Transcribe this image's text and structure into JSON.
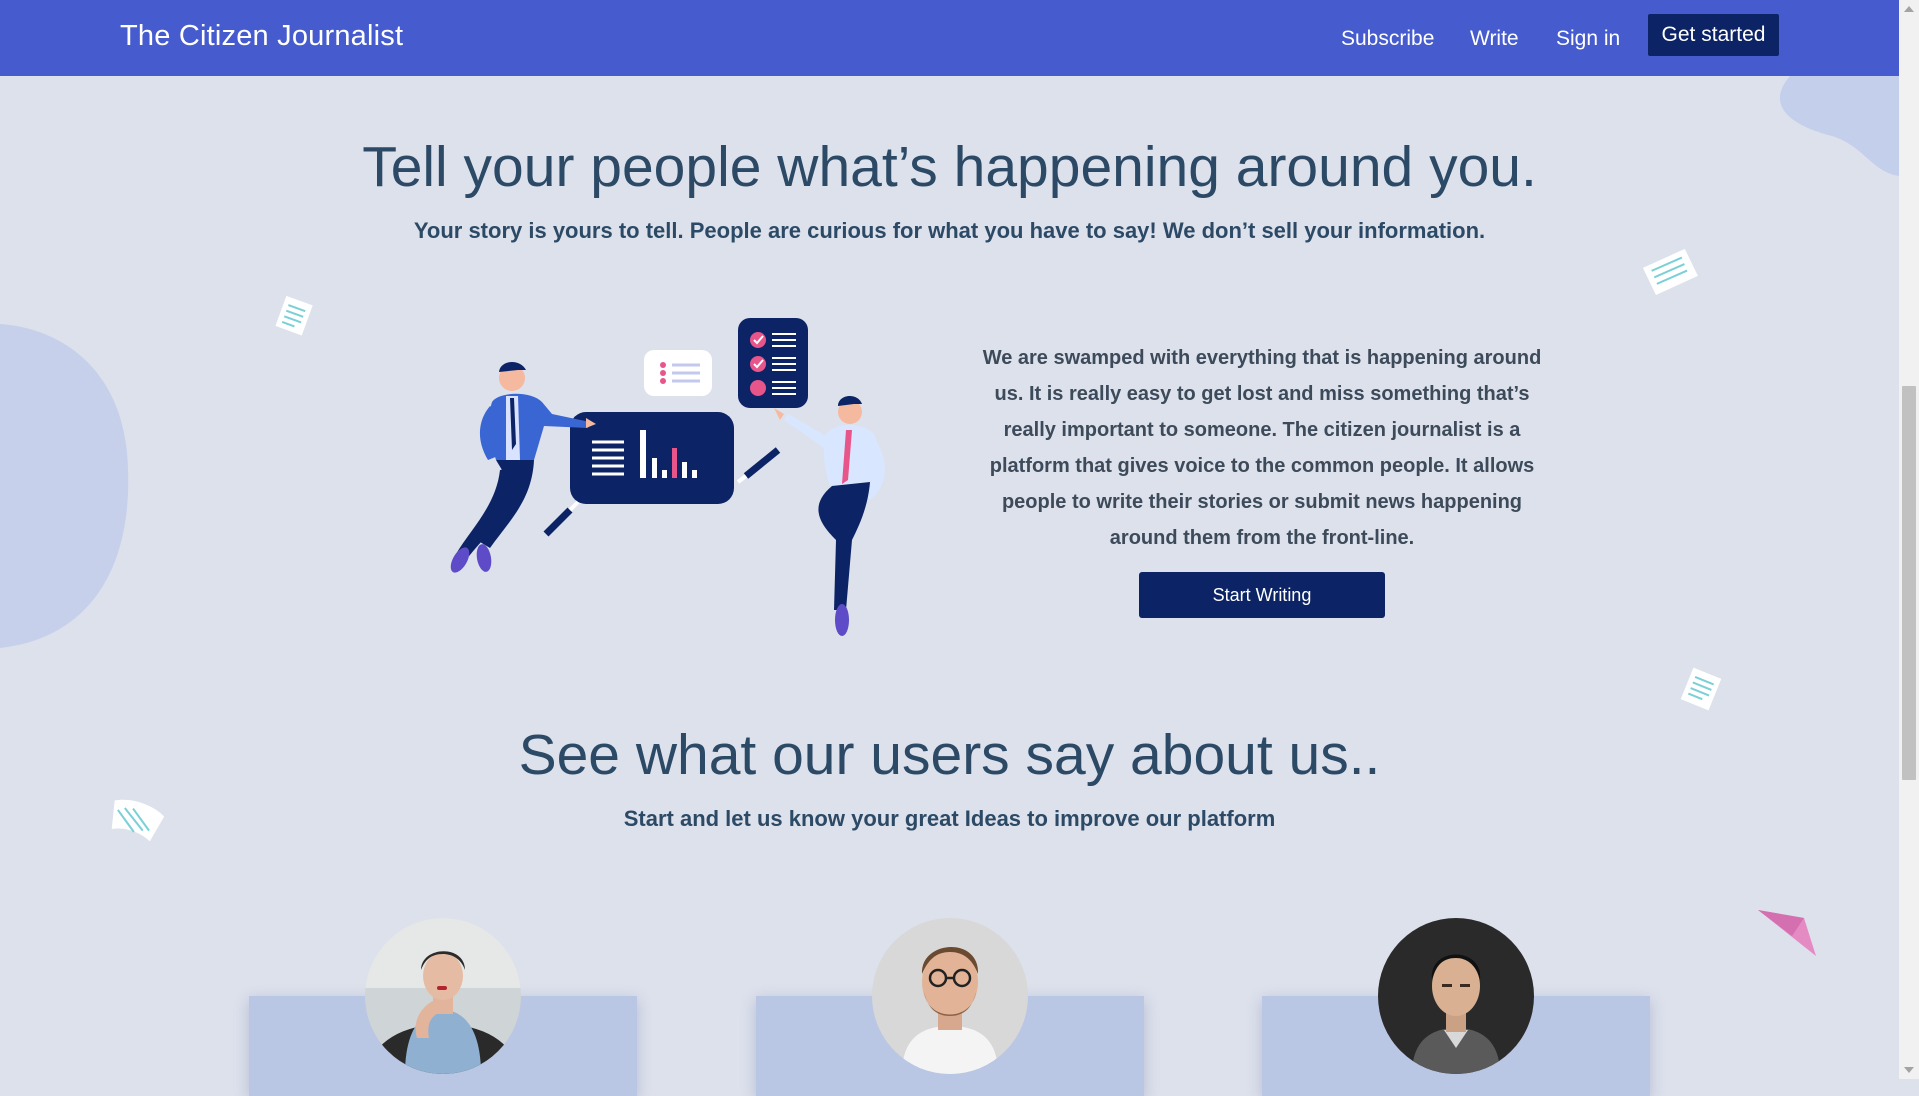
{
  "navbar": {
    "brand": "The Citizen Journalist",
    "links": [
      "Subscribe",
      "Write",
      "Sign in"
    ],
    "cta": "Get started",
    "background": "#465cce",
    "cta_background": "#0c2466"
  },
  "hero": {
    "title": "Tell your people what’s happening around you.",
    "subtitle": "Your story is yours to tell. People are curious for what you have to say! We don’t sell your information."
  },
  "about": {
    "text": "We are swamped with everything that is happening around us. It is really easy to get lost and miss something that’s really important to someone. The citizen journalist is a platform that gives voice to the common people. It allows people to write their stories or submit news happening around them from the front-line.",
    "button": "Start Writing"
  },
  "testimonials": {
    "title": "See what our users say about us..",
    "subtitle": "Start and let us know your great Ideas to improve our platform"
  },
  "icons": [
    "paper-plane-icon",
    "document-icon",
    "checklist-icon",
    "bar-chart-icon"
  ],
  "colors": {
    "page_background": "#dde1ec",
    "heading": "#2c4a66",
    "accent_pink": "#e58bc4",
    "card": "#b9c6e4"
  }
}
